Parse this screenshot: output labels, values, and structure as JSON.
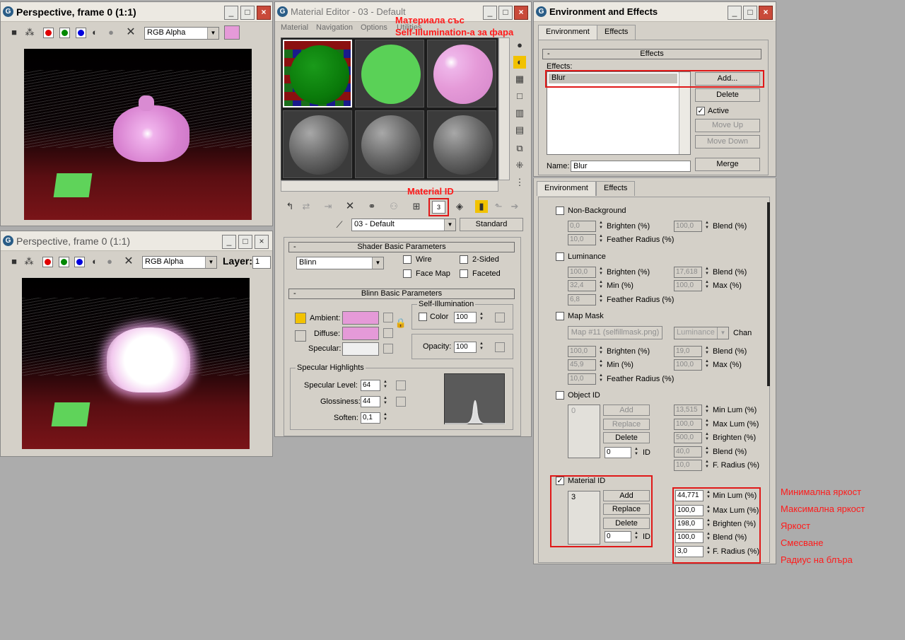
{
  "viewport1": {
    "title": "Perspective, frame 0 (1:1)",
    "channel": "RGB Alpha"
  },
  "viewport2": {
    "title": "Perspective, frame 0 (1:1)",
    "channel": "RGB Alpha",
    "layer_label": "Layer:",
    "layer_value": "1"
  },
  "matedit": {
    "title": "Material Editor - 03 - Default",
    "menu": [
      "Material",
      "Navigation",
      "Options",
      "Utilities"
    ],
    "annotation_top_1": "Материала със",
    "annotation_top_2": "Self-Illumination-а за фара",
    "annotation_matid": "Material ID",
    "matid_value": "3",
    "material_name": "03 - Default",
    "material_type": "Standard",
    "shader_title": "Shader Basic Parameters",
    "shader_value": "Blinn",
    "wire": "Wire",
    "two_sided": "2-Sided",
    "face_map": "Face Map",
    "faceted": "Faceted",
    "blinn_title": "Blinn Basic Parameters",
    "self_illum": "Self-Illumination",
    "color_label": "Color",
    "color_value": "100",
    "ambient": "Ambient:",
    "diffuse": "Diffuse:",
    "specular": "Specular:",
    "opacity_label": "Opacity:",
    "opacity_value": "100",
    "spec_highlights": "Specular Highlights",
    "spec_level": "Specular Level:",
    "spec_level_value": "64",
    "glossiness": "Glossiness:",
    "glossiness_value": "44",
    "soften": "Soften:",
    "soften_value": "0,1",
    "collapse": "-"
  },
  "envfx": {
    "title": "Environment and Effects",
    "tab_environment": "Environment",
    "tab_effects": "Effects",
    "effects_rollup": "Effects",
    "effects_label": "Effects:",
    "effect_item": "Blur",
    "add": "Add...",
    "delete": "Delete",
    "active": "Active",
    "move_up": "Move Up",
    "move_down": "Move Down",
    "name_label": "Name:",
    "name_value": "Blur",
    "merge": "Merge",
    "tab2_environment": "Environment",
    "tab2_effects": "Effects",
    "non_background": {
      "label": "Non-Background",
      "brighten_val": "0,0",
      "brighten": "Brighten (%)",
      "blend_val": "100,0",
      "blend": "Blend (%)",
      "feather_val": "10,0",
      "feather": "Feather Radius (%)"
    },
    "luminance": {
      "label": "Luminance",
      "brighten_val": "100,0",
      "brighten": "Brighten (%)",
      "blend_val": "17,618",
      "blend": "Blend (%)",
      "min_val": "32,4",
      "min": "Min (%)",
      "max_val": "100,0",
      "max": "Max (%)",
      "feather_val": "6,8",
      "feather": "Feather Radius (%)"
    },
    "map_mask": {
      "label": "Map Mask",
      "map_button": "Map #11 (selfillmask.png)",
      "channel_select": "Luminance",
      "chan": "Chan",
      "brighten_val": "100,0",
      "brighten": "Brighten (%)",
      "blend_val": "19,0",
      "blend": "Blend (%)",
      "min_val": "45,9",
      "min": "Min (%)",
      "max_val": "100,0",
      "max": "Max (%)",
      "feather_val": "10,0",
      "feather": "Feather Radius (%)"
    },
    "object_id": {
      "label": "Object ID",
      "list_item": "0",
      "add": "Add",
      "replace": "Replace",
      "delete": "Delete",
      "id_val": "0",
      "id": "ID",
      "min_lum_val": "13,515",
      "min_lum": "Min Lum (%)",
      "max_lum_val": "100,0",
      "max_lum": "Max Lum (%)",
      "brighten_val": "500,0",
      "brighten": "Brighten (%)",
      "blend_val": "40,0",
      "blend": "Blend (%)",
      "fradius_val": "10,0",
      "fradius": "F. Radius (%)"
    },
    "material_id": {
      "label": "Material ID",
      "list_item": "3",
      "add": "Add",
      "replace": "Replace",
      "delete": "Delete",
      "id_val": "0",
      "id": "ID",
      "min_lum_val": "44,771",
      "min_lum": "Min Lum (%)",
      "max_lum_val": "100,0",
      "max_lum": "Max Lum (%)",
      "brighten_val": "198,0",
      "brighten": "Brighten (%)",
      "blend_val": "100,0",
      "blend": "Blend (%)",
      "fradius_val": "3,0",
      "fradius": "F. Radius (%)"
    }
  },
  "annotations": {
    "min_lum": "Минимална яркост",
    "max_lum": "Максимална яркост",
    "brighten": "Яркост",
    "blend": "Смесване",
    "radius": "Радиус на блъра"
  },
  "colors": {
    "highlight_red": "#e01818",
    "material_pink": "#e59ad8",
    "material_green": "#5ad157"
  }
}
